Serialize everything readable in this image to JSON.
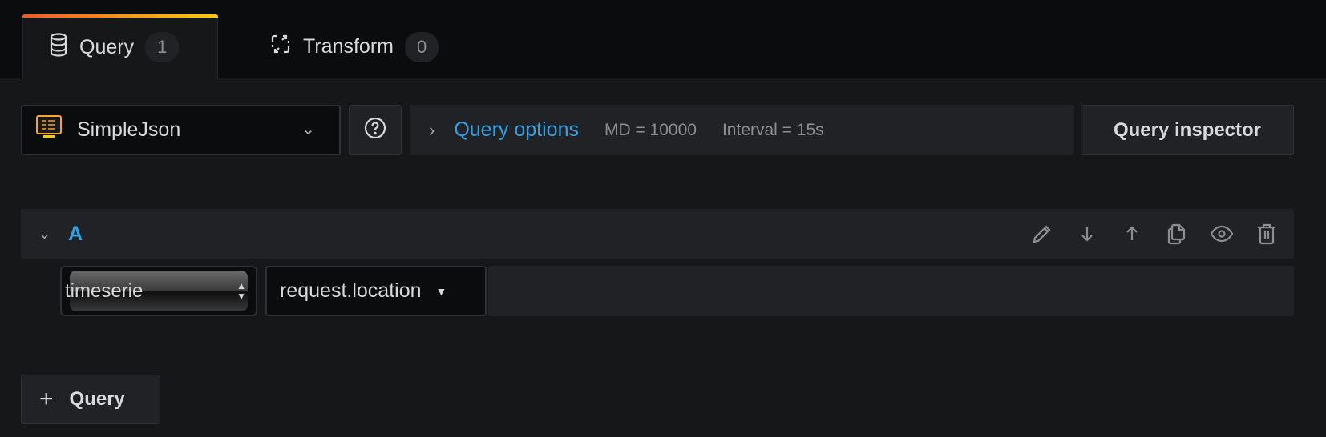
{
  "tabs": [
    {
      "label": "Query",
      "count": "1",
      "icon": "database-icon",
      "active": true
    },
    {
      "label": "Transform",
      "count": "0",
      "icon": "transform-icon",
      "active": false
    }
  ],
  "datasource": {
    "name": "SimpleJson",
    "icon": "simplejson-monitor-icon"
  },
  "query_options": {
    "label": "Query options",
    "max_data_points": "MD = 10000",
    "interval": "Interval = 15s"
  },
  "query_inspector": "Query inspector",
  "query_row": {
    "ref_id": "A",
    "actions": [
      "edit-icon",
      "move-down-icon",
      "move-up-icon",
      "duplicate-icon",
      "toggle-visibility-icon",
      "delete-icon"
    ],
    "type_select": "timeserie",
    "metric_select": "request.location"
  },
  "add_query": "Query",
  "colors": {
    "accent": "#33a2e5",
    "tab_gradient_start": "#f05a28",
    "tab_gradient_end": "#fbca0a",
    "background": "#161719",
    "panel": "#202226"
  }
}
